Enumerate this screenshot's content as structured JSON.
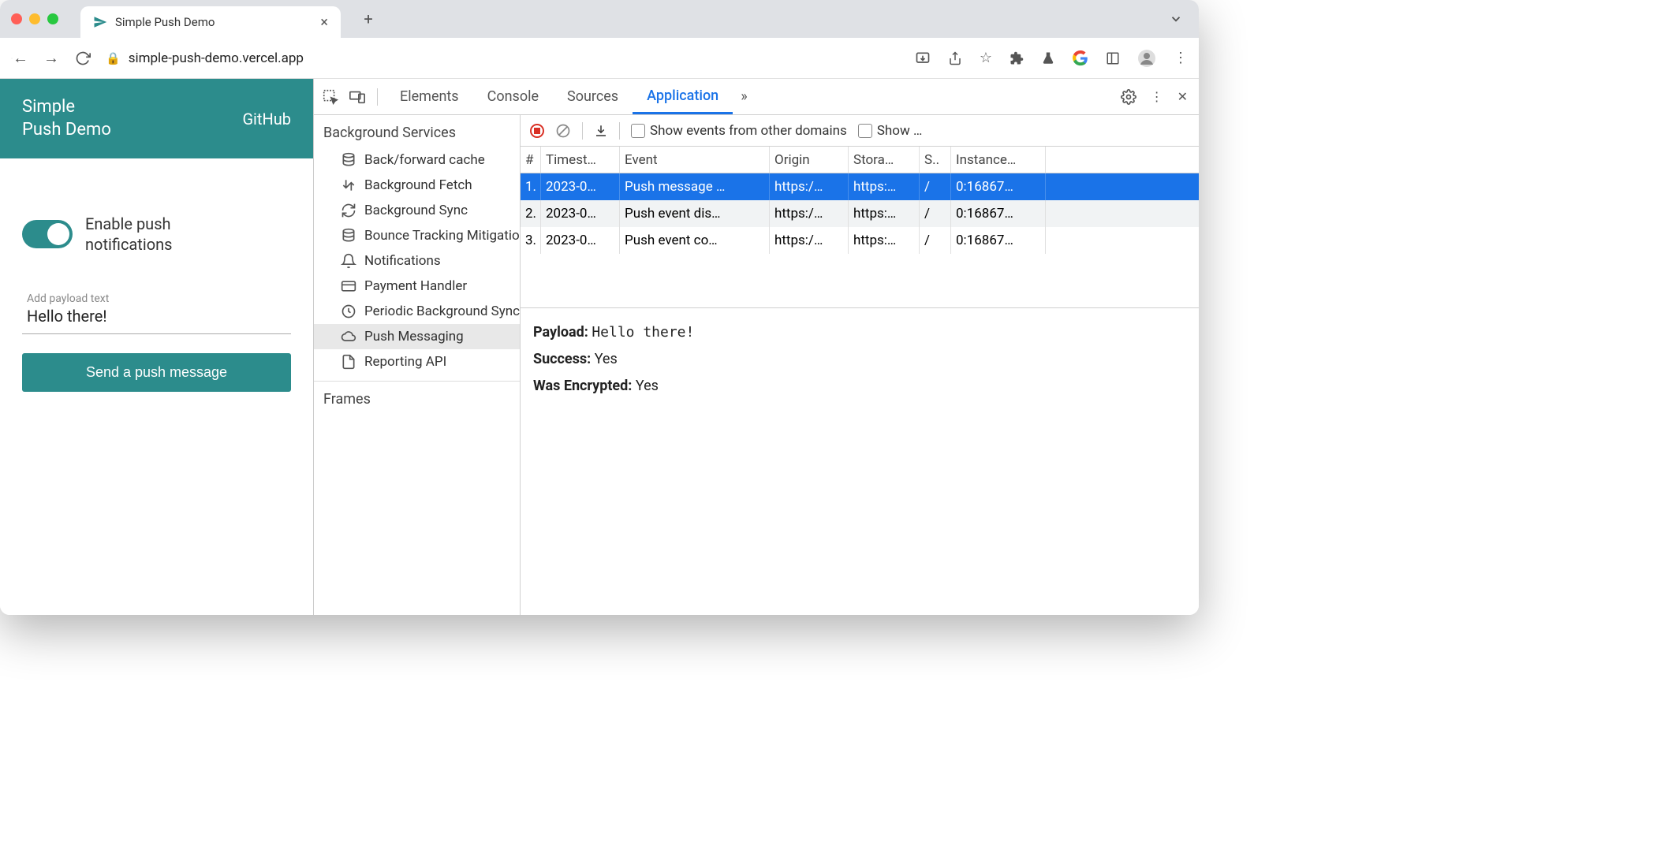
{
  "browser": {
    "tab_title": "Simple Push Demo",
    "url": "simple-push-demo.vercel.app",
    "right_icons": [
      "install-icon",
      "share-icon",
      "star-icon",
      "extensions-icon",
      "labs-icon",
      "google-icon",
      "reader-icon",
      "profile-icon",
      "kebab-icon"
    ]
  },
  "page": {
    "app_title_line1": "Simple",
    "app_title_line2": "Push Demo",
    "github_link": "GitHub",
    "toggle_label_line1": "Enable push",
    "toggle_label_line2": "notifications",
    "toggle_on": true,
    "payload_label": "Add payload text",
    "payload_value": "Hello there!",
    "send_button": "Send a push message"
  },
  "devtools": {
    "tabs": [
      "Elements",
      "Console",
      "Sources",
      "Application"
    ],
    "active_tab": "Application",
    "sidebar": {
      "section": "Background Services",
      "items": [
        {
          "icon": "database",
          "label": "Back/forward cache"
        },
        {
          "icon": "fetch",
          "label": "Background Fetch"
        },
        {
          "icon": "sync",
          "label": "Background Sync"
        },
        {
          "icon": "database",
          "label": "Bounce Tracking Mitigations"
        },
        {
          "icon": "bell",
          "label": "Notifications"
        },
        {
          "icon": "card",
          "label": "Payment Handler"
        },
        {
          "icon": "clock",
          "label": "Periodic Background Sync"
        },
        {
          "icon": "cloud",
          "label": "Push Messaging",
          "selected": true
        },
        {
          "icon": "file",
          "label": "Reporting API"
        }
      ],
      "section2": "Frames"
    },
    "toolbar": {
      "show_other_domains": "Show events from other domains",
      "show_truncated": "Show …"
    },
    "table": {
      "columns": [
        "#",
        "Timest…",
        "Event",
        "Origin",
        "Stora…",
        "S..",
        "Instance…"
      ],
      "rows": [
        {
          "n": "1.",
          "ts": "2023-0…",
          "event": "Push message …",
          "origin": "https:/…",
          "storage": "https:…",
          "scope": "/",
          "instance": "0:16867…",
          "selected": true
        },
        {
          "n": "2.",
          "ts": "2023-0…",
          "event": "Push event dis…",
          "origin": "https:/…",
          "storage": "https:…",
          "scope": "/",
          "instance": "0:16867…"
        },
        {
          "n": "3.",
          "ts": "2023-0…",
          "event": "Push event co…",
          "origin": "https:/…",
          "storage": "https:…",
          "scope": "/",
          "instance": "0:16867…"
        }
      ]
    },
    "details": {
      "payload_label": "Payload:",
      "payload_value": "Hello there!",
      "success_label": "Success:",
      "success_value": "Yes",
      "encrypted_label": "Was Encrypted:",
      "encrypted_value": "Yes"
    }
  }
}
